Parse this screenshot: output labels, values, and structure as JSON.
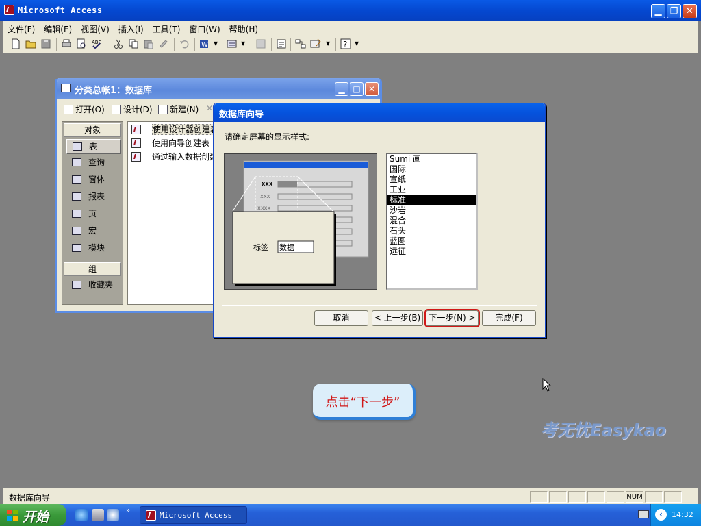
{
  "app": {
    "title": "Microsoft Access"
  },
  "menu": {
    "items": [
      "文件(F)",
      "编辑(E)",
      "视图(V)",
      "插入(I)",
      "工具(T)",
      "窗口(W)",
      "帮助(H)"
    ]
  },
  "db_window": {
    "title": "分类总帐1：数据库",
    "toolbar": {
      "open": "打开(O)",
      "design": "设计(D)",
      "new": "新建(N)"
    },
    "objects_header": "对象",
    "objects": [
      "表",
      "查询",
      "窗体",
      "报表",
      "页",
      "宏",
      "模块"
    ],
    "groups_header": "组",
    "groups": [
      "收藏夹"
    ],
    "list": [
      "使用设计器创建表",
      "使用向导创建表",
      "通过输入数据创建"
    ]
  },
  "wizard": {
    "title": "数据库向导",
    "prompt": "请确定屏幕的显示样式:",
    "preview_label": "标签",
    "preview_value": "数据",
    "preview_xxx": [
      "xxx",
      "xxx",
      "xxxx"
    ],
    "styles": [
      "Sumi 画",
      "国际",
      "宣纸",
      "工业",
      "标准",
      "沙岩",
      "混合",
      "石头",
      "蓝图",
      "远征"
    ],
    "selected_style": "标准",
    "buttons": {
      "cancel": "取消",
      "back": "< 上一步(B)",
      "next": "下一步(N) >",
      "finish": "完成(F)"
    }
  },
  "callout": {
    "text": "点击“下一步”"
  },
  "watermark": {
    "text": "考无忧Easykao"
  },
  "statusbar": {
    "text": "数据库向导",
    "indicator": "NUM"
  },
  "taskbar": {
    "start": "开始",
    "task": "Microsoft Access",
    "clock": "14:32"
  },
  "colors": {
    "titlebar": "#0548d0",
    "highlight_box": "#d01818",
    "callout_text": "#d01818"
  }
}
